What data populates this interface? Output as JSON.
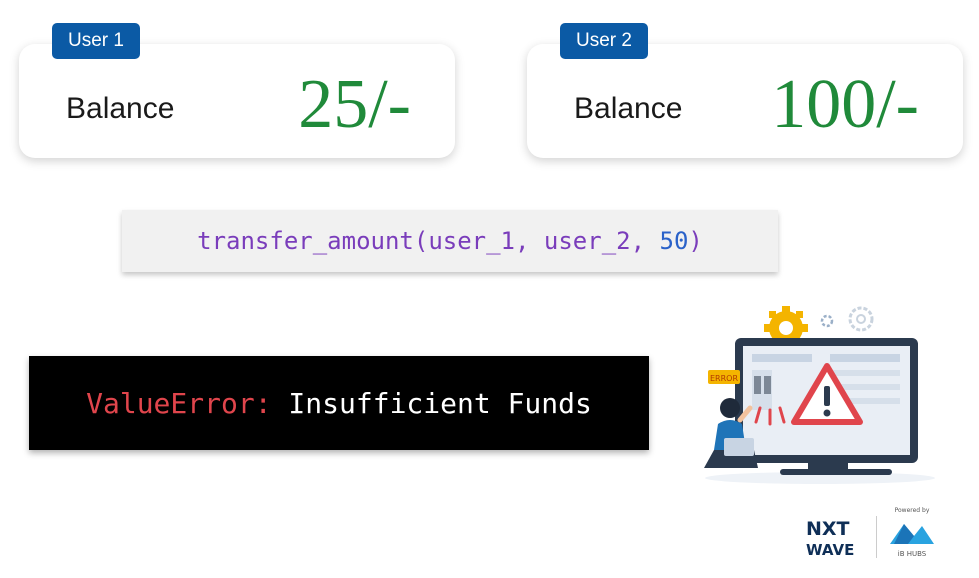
{
  "user1": {
    "tag": "User 1",
    "label": "Balance",
    "value": "25/-"
  },
  "user2": {
    "tag": "User 2",
    "label": "Balance",
    "value": "100/-"
  },
  "code": {
    "call": "transfer_amount(user_1, user_2, ",
    "amount": "50",
    "close": ")"
  },
  "error": {
    "type": "ValueError:",
    "message": "Insufficient Funds"
  },
  "illustration": {
    "icon": "error-warning-illustration",
    "badge_text": "ERROR"
  },
  "logos": {
    "nxt_line1": "NXT",
    "nxt_line2": "WAVE",
    "powered_by": "Powered by",
    "ib_text": "iB HUBS"
  },
  "colors": {
    "accent": "#0b5aa5",
    "balance": "#208a3a",
    "error": "#e0454c",
    "code": "#7a3dbb",
    "number": "#2a62c9"
  }
}
